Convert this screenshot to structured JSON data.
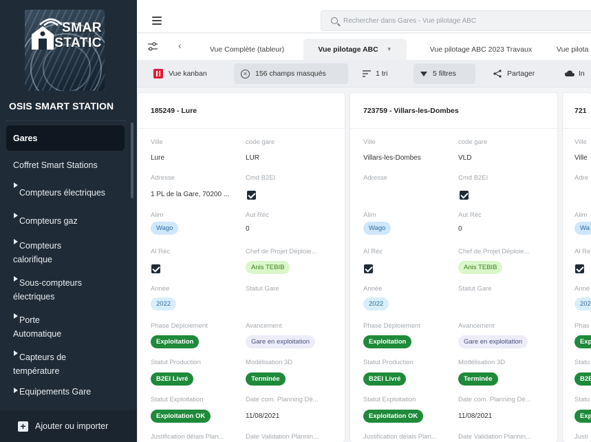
{
  "sidebar": {
    "logo_text_1": "SMAR",
    "logo_text_2": "STATIC",
    "workspace_name": "OSIS SMART STATION",
    "items": [
      {
        "label": "Gares",
        "active": true
      },
      {
        "label": "Coffret Smart Stations"
      },
      {
        "label": "Compteurs électriques",
        "expandable": true
      },
      {
        "label": "Compteurs gaz",
        "expandable": true
      },
      {
        "label": "Compteurs calorifique",
        "expandable": true
      },
      {
        "label": "Sous-compteurs électriques",
        "expandable": true
      },
      {
        "label": "Porte Automatique",
        "expandable": true
      },
      {
        "label": "Capteurs de température",
        "expandable": true
      },
      {
        "label": "Equipements Gare",
        "expandable": true
      }
    ],
    "add_import_label": "Ajouter ou importer"
  },
  "topbar": {
    "search_placeholder": "Rechercher dans Gares - Vue pilotage ABC"
  },
  "tabs": [
    {
      "label": "Vue Complète (tableur)"
    },
    {
      "label": "Vue pilotage ABC",
      "active": true
    },
    {
      "label": "Vue pilotage ABC 2023 Travaux"
    },
    {
      "label": "Vue pilota"
    }
  ],
  "toolbar": {
    "kanban": "Vue kanban",
    "hidden_fields": "156 champs masqués",
    "sort": "1 tri",
    "filters": "5 filtres",
    "share": "Partager",
    "import": "In"
  },
  "labels": {
    "ville": "Ville",
    "code_gare": "code gare",
    "adresse": "Adresse",
    "cmd_b2ei": "Cmd B2EI",
    "alim": "Alim",
    "aut_rec": "Aut Réc",
    "al_rec": "Al Réc",
    "chef_projet": "Chef de Projet Déploie...",
    "annee": "Année",
    "statut_gare": "Statut Gare",
    "phase": "Phase Déploiement",
    "avancement": "Avancement",
    "statut_production": "Statut Production",
    "modelisation": "Modélisation 3D",
    "statut_exploitation": "Statut Exploitation",
    "date_com": "Date com. Planning Dé...",
    "justification": "Justification délais Plan...",
    "date_validation": "Date Validation Plannin..."
  },
  "cards": [
    {
      "title": "185249 - Lure",
      "ville": "Lure",
      "code_gare": "LUR",
      "adresse": "1 PL de la Gare, 70200 ...",
      "alim": "Wago",
      "aut_rec": "0",
      "chef_projet": "Anis TEBIB",
      "annee": "2022",
      "phase": "Exploitation",
      "avancement": "Gare en exploitation",
      "statut_production": "B2EI Livré",
      "modelisation": "Terminée",
      "statut_exploitation": "Exploitation OK",
      "date_com": "11/08/2021"
    },
    {
      "title": "723759 - Villars-les-Dombes",
      "ville": "Villars-les-Dombes",
      "code_gare": "VLD",
      "adresse": "",
      "alim": "Wago",
      "aut_rec": "0",
      "chef_projet": "Anis TEBIB",
      "annee": "2022",
      "phase": "Exploitation",
      "avancement": "Gare en exploitation",
      "statut_production": "B2EI Livré",
      "modelisation": "Terminée",
      "statut_exploitation": "Exploitation OK",
      "date_com": "11/08/2021"
    },
    {
      "title": "721",
      "ville_label": "Ville",
      "ville": "Ville",
      "adresse_label": "Adre",
      "alim_label": "Alim",
      "alim": "Wa",
      "al_rec_label": "Al Re",
      "annee_label": "Anné",
      "annee": "202",
      "phase_label": "Phas",
      "phase": "Exp",
      "statut_production_label": "Statu",
      "statut_production": "B2E",
      "statut_exploitation_label": "Statu",
      "statut_exploitation": "Exp",
      "justification_label": "Justi"
    }
  ]
}
